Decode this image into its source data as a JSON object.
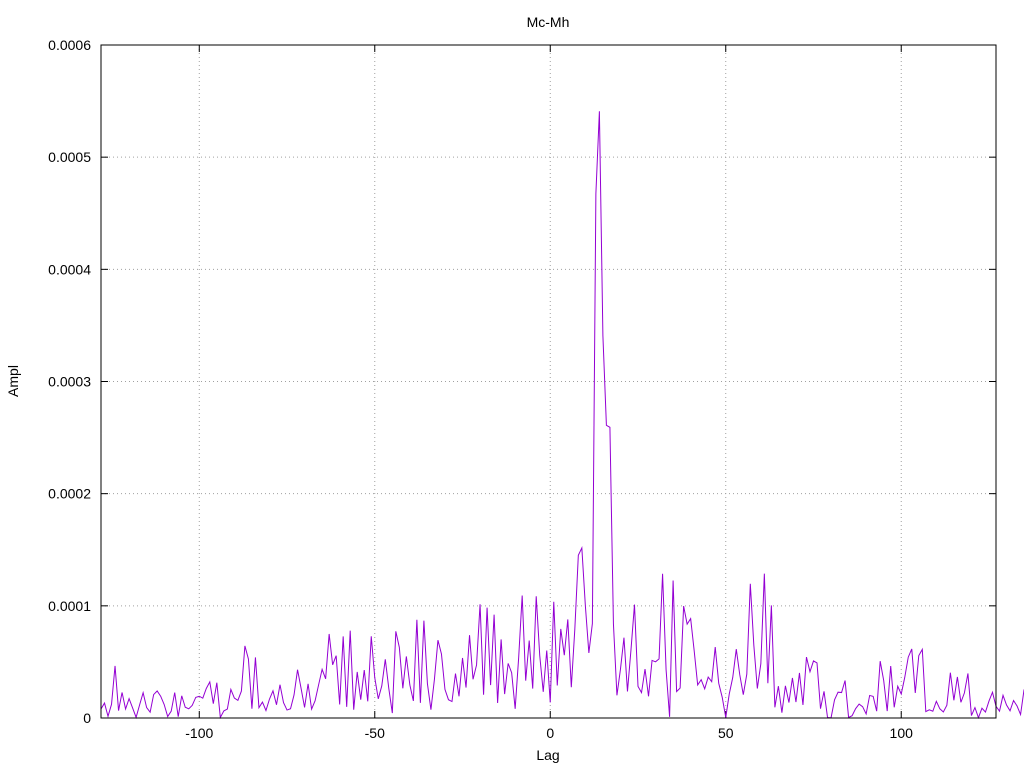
{
  "chart_data": {
    "type": "line",
    "title": "Mc-Mh",
    "xlabel": "Lag",
    "ylabel": "Ampl",
    "xlim": [
      -128,
      127
    ],
    "ylim": [
      0,
      0.0006
    ],
    "grid": true,
    "x_ticks": [
      -100,
      -50,
      0,
      50,
      100
    ],
    "x_tick_labels": [
      "-100",
      "-50",
      "0",
      "50",
      "100"
    ],
    "y_ticks": [
      0,
      0.0001,
      0.0002,
      0.0003,
      0.0004,
      0.0005,
      0.0006
    ],
    "y_tick_labels": [
      "0",
      "0.0001",
      "0.0002",
      "0.0003",
      "0.0004",
      "0.0005",
      "0.0006"
    ],
    "series": [
      {
        "color": "#9400d3",
        "x_start": -128,
        "x_step": 1,
        "values": [
          8e-06,
          1.33e-05,
          1.5e-06,
          1.22e-05,
          4.64e-05,
          6.6e-06,
          2.28e-05,
          8e-06,
          1.73e-05,
          9e-06,
          6e-07,
          1.17e-05,
          2.25e-05,
          9.3e-06,
          5.2e-06,
          2.09e-05,
          2.41e-05,
          1.94e-05,
          1.2e-05,
          1.3e-06,
          6.1e-06,
          2.27e-05,
          1.2e-06,
          1.98e-05,
          9.6e-06,
          8.2e-06,
          1.13e-05,
          1.84e-05,
          1.94e-05,
          1.77e-05,
          2.63e-05,
          3.22e-05,
          1.28e-05,
          3.15e-05,
          5e-07,
          6.3e-06,
          8e-06,
          2.55e-05,
          1.78e-05,
          1.57e-05,
          2.4e-05,
          6.43e-05,
          5.26e-05,
          8.3e-06,
          5.4e-05,
          9.2e-06,
          1.42e-05,
          6.7e-06,
          1.68e-05,
          2.42e-05,
          1.18e-05,
          2.97e-05,
          1.37e-05,
          7.1e-06,
          8.3e-06,
          2.06e-05,
          4.31e-05,
          2.65e-05,
          9.4e-06,
          3.05e-05,
          7.9e-06,
          1.54e-05,
          2.96e-05,
          4.34e-05,
          3.49e-05,
          7.49e-05,
          4.74e-05,
          5.56e-05,
          1.21e-05,
          7.28e-05,
          9.9e-06,
          7.79e-05,
          7.4e-06,
          4.11e-05,
          1.63e-05,
          4.27e-05,
          1.49e-05,
          7.29e-05,
          3.59e-05,
          1.71e-05,
          2.86e-05,
          5.23e-05,
          2.64e-05,
          4.4e-06,
          7.73e-05,
          6.3e-05,
          2.65e-05,
          5.49e-05,
          2.94e-05,
          1.52e-05,
          8.76e-05,
          1.35e-05,
          8.68e-05,
          3.07e-05,
          7.4e-06,
          3.45e-05,
          6.94e-05,
          5.71e-05,
          2.55e-05,
          1.63e-05,
          1.47e-05,
          3.96e-05,
          1.93e-05,
          5.35e-05,
          2.71e-05,
          7.38e-05,
          3.45e-05,
          4.73e-05,
          0.0001014,
          2.08e-05,
          9.84e-05,
          2.93e-05,
          9.21e-05,
          1.34e-05,
          7.01e-05,
          2.13e-05,
          4.87e-05,
          4.04e-05,
          8.2e-06,
          5.39e-05,
          0.0001092,
          3.33e-05,
          6.91e-05,
          2.62e-05,
          0.0001085,
          5.58e-05,
          2.33e-05,
          6.02e-05,
          1.39e-05,
          0.0001036,
          2.9e-05,
          7.94e-05,
          5.6e-05,
          8.79e-05,
          2.74e-05,
          7.92e-05,
          0.0001451,
          0.0001516,
          0.0001002,
          5.8e-05,
          8.42e-05,
          0.0004674,
          0.0005409,
          0.0003408,
          0.0002609,
          0.0002592,
          8.39e-05,
          2.02e-05,
          4.34e-05,
          7.16e-05,
          2.37e-05,
          6.08e-05,
          0.0001011,
          2.82e-05,
          2.26e-05,
          4.36e-05,
          1.93e-05,
          5.13e-05,
          5.01e-05,
          5.27e-05,
          0.0001286,
          4.31e-05,
          1e-06,
          0.0001226,
          2.36e-05,
          2.67e-05,
          9.98e-05,
          8.37e-05,
          8.86e-05,
          6.01e-05,
          2.95e-05,
          3.41e-05,
          2.6e-05,
          3.65e-05,
          3.24e-05,
          6.32e-05,
          3.1e-05,
          1.84e-05,
          5e-07,
          2.14e-05,
          3.62e-05,
          6.14e-05,
          3.85e-05,
          2.08e-05,
          3.91e-05,
          0.0001197,
          6.49e-05,
          2.63e-05,
          4.84e-05,
          0.0001287,
          3.1e-05,
          0.0001004,
          9.5e-06,
          2.84e-05,
          4.7e-06,
          2.87e-05,
          1.38e-05,
          3.57e-05,
          1.42e-05,
          4.02e-05,
          1.16e-05,
          5.43e-05,
          4.12e-05,
          5.09e-05,
          4.91e-05,
          8.3e-06,
          2.38e-05,
          5e-07,
          1e-07,
          1.62e-05,
          2.3e-05,
          2.27e-05,
          3.34e-05,
          5e-07,
          2e-06,
          8.3e-06,
          1.24e-05,
          1.01e-05,
          3.6e-06,
          2.01e-05,
          1.93e-05,
          6.1e-06,
          5.07e-05,
          3.35e-05,
          6.2e-06,
          4.63e-05,
          9.5e-06,
          2.83e-05,
          2.14e-05,
          3.62e-05,
          5.42e-05,
          6.16e-05,
          2.23e-05,
          5.56e-05,
          6.12e-05,
          5.7e-06,
          7.3e-06,
          6e-06,
          1.49e-05,
          8.2e-06,
          5.4e-06,
          1.14e-05,
          4.04e-05,
          1.58e-05,
          3.66e-05,
          1.4e-05,
          2.24e-05,
          3.97e-05,
          2.2e-06,
          9.3e-06,
          3e-07,
          8.7e-06,
          5.3e-06,
          1.51e-05,
          2.3e-05,
          1.04e-05,
          6.1e-06,
          2.02e-05,
          1.16e-05,
          6.4e-06,
          1.56e-05,
          1.07e-05,
          3.1e-06,
          2.55e-05
        ]
      }
    ]
  }
}
